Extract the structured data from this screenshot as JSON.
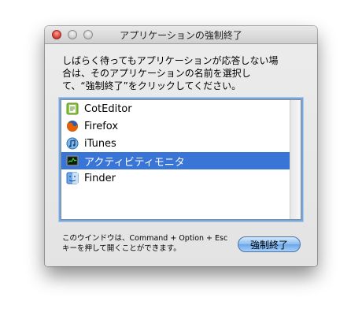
{
  "window": {
    "title": "アプリケーションの強制終了",
    "controls": [
      "close",
      "minimize",
      "zoom"
    ]
  },
  "message": {
    "line1": "しばらく待ってもアプリケーションが応答しない場",
    "line2": "合は、そのアプリケーションの名前を選択し",
    "line3": "て、“強制終了”をクリックしてください。"
  },
  "apps": {
    "items": [
      {
        "label": "CotEditor",
        "icon": "coteditor-icon",
        "selected": false
      },
      {
        "label": "Firefox",
        "icon": "firefox-icon",
        "selected": false
      },
      {
        "label": "iTunes",
        "icon": "itunes-icon",
        "selected": false
      },
      {
        "label": "アクティビティモニタ",
        "icon": "activity-monitor-icon",
        "selected": true
      },
      {
        "label": "Finder",
        "icon": "finder-icon",
        "selected": false
      }
    ]
  },
  "help": {
    "line1": "このウインドウは、Command + Option + Esc",
    "line2": "キーを押して開くことができます。"
  },
  "buttons": {
    "force_quit": "強制終了"
  },
  "colors": {
    "selection": "#3875d7",
    "focus_ring": "#74a6e0",
    "default_button": "#8bbcf0"
  }
}
